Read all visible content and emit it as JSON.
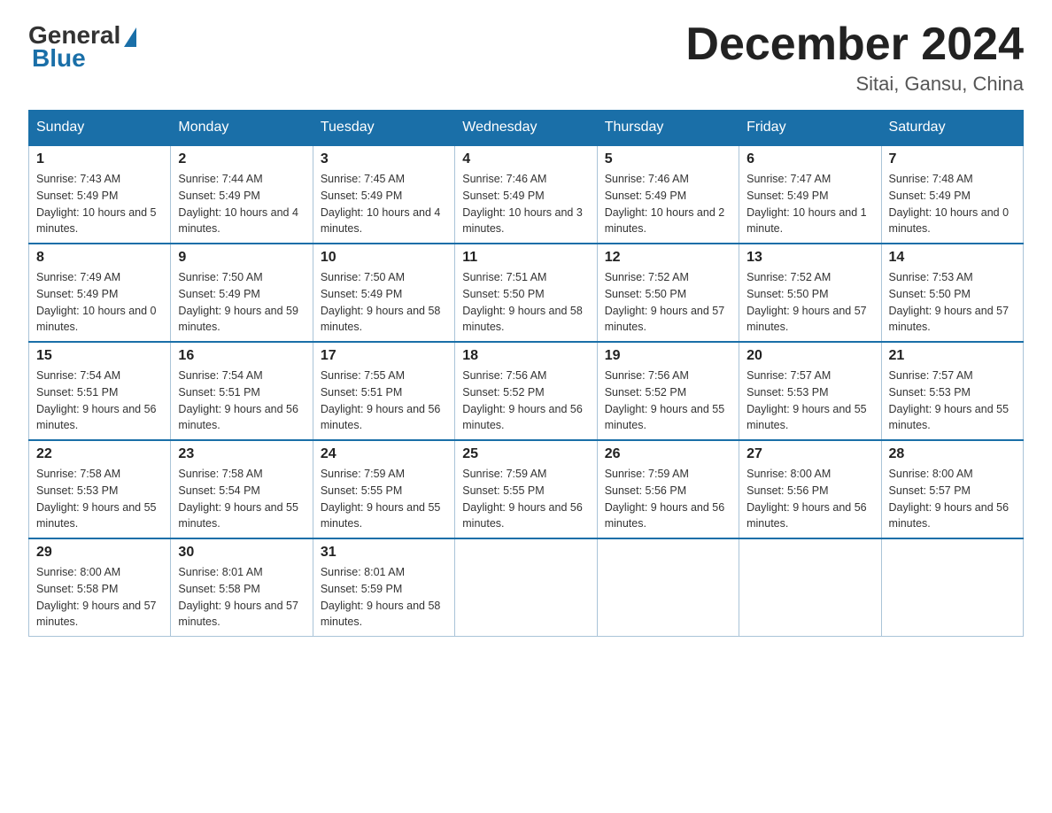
{
  "logo": {
    "general": "General",
    "blue": "Blue",
    "underline": "Blue"
  },
  "title": "December 2024",
  "location": "Sitai, Gansu, China",
  "days_of_week": [
    "Sunday",
    "Monday",
    "Tuesday",
    "Wednesday",
    "Thursday",
    "Friday",
    "Saturday"
  ],
  "weeks": [
    [
      {
        "day": "1",
        "sunrise": "7:43 AM",
        "sunset": "5:49 PM",
        "daylight": "10 hours and 5 minutes."
      },
      {
        "day": "2",
        "sunrise": "7:44 AM",
        "sunset": "5:49 PM",
        "daylight": "10 hours and 4 minutes."
      },
      {
        "day": "3",
        "sunrise": "7:45 AM",
        "sunset": "5:49 PM",
        "daylight": "10 hours and 4 minutes."
      },
      {
        "day": "4",
        "sunrise": "7:46 AM",
        "sunset": "5:49 PM",
        "daylight": "10 hours and 3 minutes."
      },
      {
        "day": "5",
        "sunrise": "7:46 AM",
        "sunset": "5:49 PM",
        "daylight": "10 hours and 2 minutes."
      },
      {
        "day": "6",
        "sunrise": "7:47 AM",
        "sunset": "5:49 PM",
        "daylight": "10 hours and 1 minute."
      },
      {
        "day": "7",
        "sunrise": "7:48 AM",
        "sunset": "5:49 PM",
        "daylight": "10 hours and 0 minutes."
      }
    ],
    [
      {
        "day": "8",
        "sunrise": "7:49 AM",
        "sunset": "5:49 PM",
        "daylight": "10 hours and 0 minutes."
      },
      {
        "day": "9",
        "sunrise": "7:50 AM",
        "sunset": "5:49 PM",
        "daylight": "9 hours and 59 minutes."
      },
      {
        "day": "10",
        "sunrise": "7:50 AM",
        "sunset": "5:49 PM",
        "daylight": "9 hours and 58 minutes."
      },
      {
        "day": "11",
        "sunrise": "7:51 AM",
        "sunset": "5:50 PM",
        "daylight": "9 hours and 58 minutes."
      },
      {
        "day": "12",
        "sunrise": "7:52 AM",
        "sunset": "5:50 PM",
        "daylight": "9 hours and 57 minutes."
      },
      {
        "day": "13",
        "sunrise": "7:52 AM",
        "sunset": "5:50 PM",
        "daylight": "9 hours and 57 minutes."
      },
      {
        "day": "14",
        "sunrise": "7:53 AM",
        "sunset": "5:50 PM",
        "daylight": "9 hours and 57 minutes."
      }
    ],
    [
      {
        "day": "15",
        "sunrise": "7:54 AM",
        "sunset": "5:51 PM",
        "daylight": "9 hours and 56 minutes."
      },
      {
        "day": "16",
        "sunrise": "7:54 AM",
        "sunset": "5:51 PM",
        "daylight": "9 hours and 56 minutes."
      },
      {
        "day": "17",
        "sunrise": "7:55 AM",
        "sunset": "5:51 PM",
        "daylight": "9 hours and 56 minutes."
      },
      {
        "day": "18",
        "sunrise": "7:56 AM",
        "sunset": "5:52 PM",
        "daylight": "9 hours and 56 minutes."
      },
      {
        "day": "19",
        "sunrise": "7:56 AM",
        "sunset": "5:52 PM",
        "daylight": "9 hours and 55 minutes."
      },
      {
        "day": "20",
        "sunrise": "7:57 AM",
        "sunset": "5:53 PM",
        "daylight": "9 hours and 55 minutes."
      },
      {
        "day": "21",
        "sunrise": "7:57 AM",
        "sunset": "5:53 PM",
        "daylight": "9 hours and 55 minutes."
      }
    ],
    [
      {
        "day": "22",
        "sunrise": "7:58 AM",
        "sunset": "5:53 PM",
        "daylight": "9 hours and 55 minutes."
      },
      {
        "day": "23",
        "sunrise": "7:58 AM",
        "sunset": "5:54 PM",
        "daylight": "9 hours and 55 minutes."
      },
      {
        "day": "24",
        "sunrise": "7:59 AM",
        "sunset": "5:55 PM",
        "daylight": "9 hours and 55 minutes."
      },
      {
        "day": "25",
        "sunrise": "7:59 AM",
        "sunset": "5:55 PM",
        "daylight": "9 hours and 56 minutes."
      },
      {
        "day": "26",
        "sunrise": "7:59 AM",
        "sunset": "5:56 PM",
        "daylight": "9 hours and 56 minutes."
      },
      {
        "day": "27",
        "sunrise": "8:00 AM",
        "sunset": "5:56 PM",
        "daylight": "9 hours and 56 minutes."
      },
      {
        "day": "28",
        "sunrise": "8:00 AM",
        "sunset": "5:57 PM",
        "daylight": "9 hours and 56 minutes."
      }
    ],
    [
      {
        "day": "29",
        "sunrise": "8:00 AM",
        "sunset": "5:58 PM",
        "daylight": "9 hours and 57 minutes."
      },
      {
        "day": "30",
        "sunrise": "8:01 AM",
        "sunset": "5:58 PM",
        "daylight": "9 hours and 57 minutes."
      },
      {
        "day": "31",
        "sunrise": "8:01 AM",
        "sunset": "5:59 PM",
        "daylight": "9 hours and 58 minutes."
      },
      null,
      null,
      null,
      null
    ]
  ]
}
